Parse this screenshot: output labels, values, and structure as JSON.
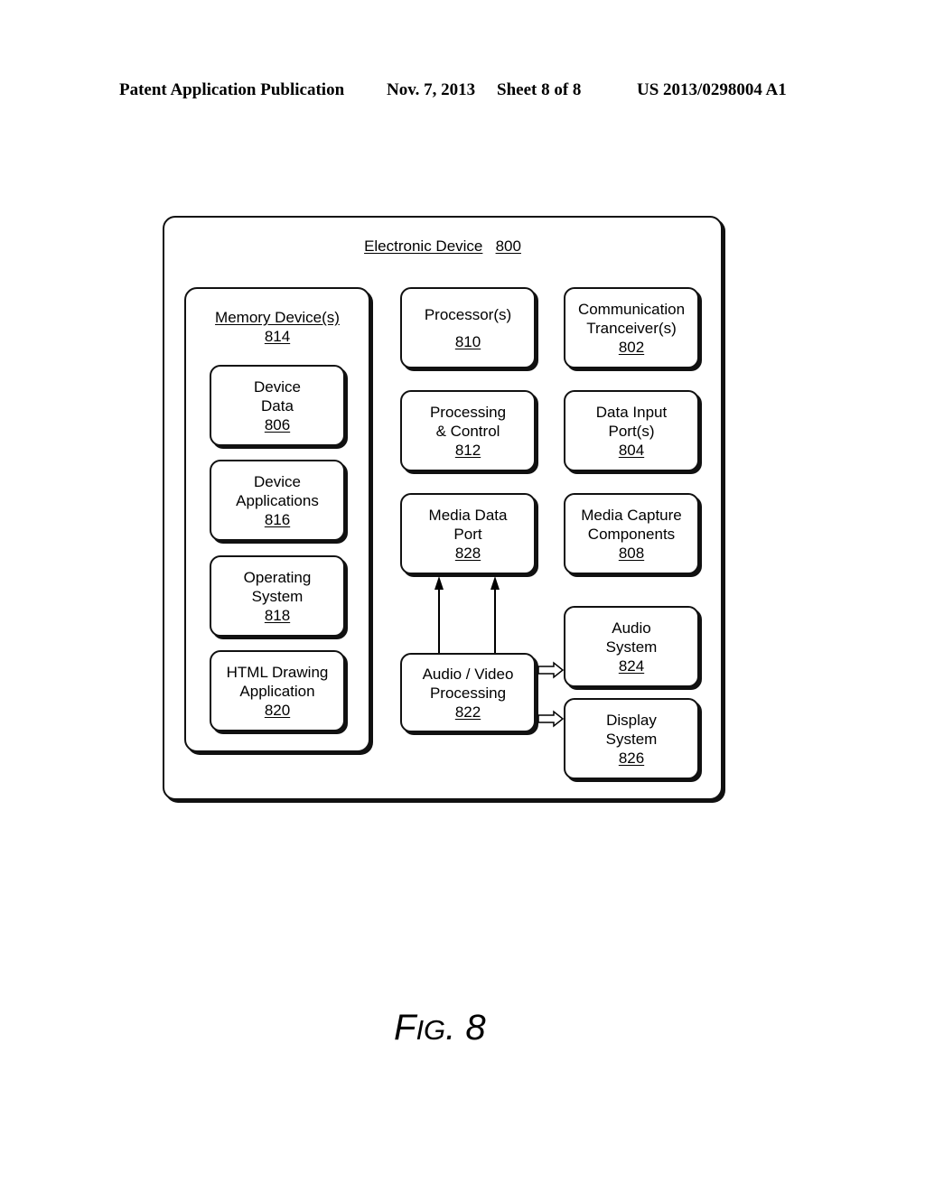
{
  "header": {
    "publication": "Patent Application Publication",
    "date": "Nov. 7, 2013",
    "sheet": "Sheet 8 of 8",
    "patent_number": "US 2013/0298004 A1"
  },
  "diagram": {
    "outer": {
      "title": "Electronic Device",
      "ref": "800"
    },
    "memory_group": {
      "title": "Memory Device(s)",
      "ref": "814"
    },
    "boxes": {
      "device_data": {
        "lines": [
          "Device",
          "Data"
        ],
        "ref": "806"
      },
      "device_applications": {
        "lines": [
          "Device",
          "Applications"
        ],
        "ref": "816"
      },
      "operating_system": {
        "lines": [
          "Operating",
          "System"
        ],
        "ref": "818"
      },
      "html_drawing_application": {
        "lines": [
          "HTML Drawing",
          "Application"
        ],
        "ref": "820"
      },
      "processors": {
        "lines": [
          "Processor(s)"
        ],
        "ref": "810"
      },
      "communication_transceivers": {
        "lines": [
          "Communication",
          "Tranceiver(s)"
        ],
        "ref": "802"
      },
      "processing_control": {
        "lines": [
          "Processing",
          "& Control"
        ],
        "ref": "812"
      },
      "data_input_ports": {
        "lines": [
          "Data Input",
          "Port(s)"
        ],
        "ref": "804"
      },
      "media_data_port": {
        "lines": [
          "Media Data",
          "Port"
        ],
        "ref": "828"
      },
      "media_capture_components": {
        "lines": [
          "Media Capture",
          "Components"
        ],
        "ref": "808"
      },
      "audio_system": {
        "lines": [
          "Audio",
          "System"
        ],
        "ref": "824"
      },
      "audio_video_processing": {
        "lines": [
          "Audio / Video",
          "Processing"
        ],
        "ref": "822"
      },
      "display_system": {
        "lines": [
          "Display",
          "System"
        ],
        "ref": "826"
      }
    },
    "connections": [
      {
        "from": "audio_video_processing",
        "to": "media_data_port",
        "style": "solid-arrow"
      },
      {
        "from": "audio_video_processing",
        "to": "media_data_port",
        "style": "solid-arrow"
      },
      {
        "from": "audio_video_processing",
        "to": "audio_system",
        "style": "hollow-arrow"
      },
      {
        "from": "audio_video_processing",
        "to": "display_system",
        "style": "hollow-arrow"
      }
    ]
  },
  "figure_label": {
    "prefix_big": "F",
    "prefix_small": "IG",
    "suffix": ". 8"
  }
}
